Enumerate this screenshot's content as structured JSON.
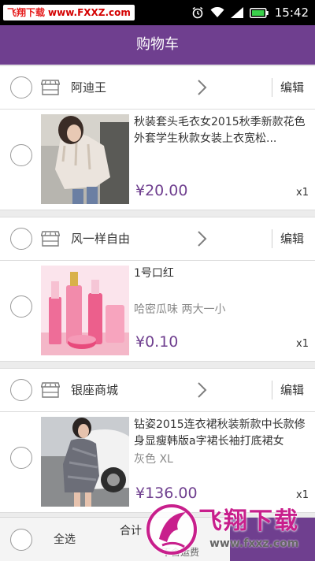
{
  "status_bar": {
    "watermark_name": "飞翔下载",
    "watermark_url": "www.FXXZ.com",
    "time": "15:42",
    "icons": [
      "alarm-icon",
      "wifi-icon",
      "signal-icon",
      "battery-icon"
    ]
  },
  "header": {
    "title": "购物车"
  },
  "shops": [
    {
      "name": "阿迪王",
      "edit_label": "编辑",
      "item": {
        "title": "秋装套头毛衣女2015秋季新款花色外套学生秋款女装上衣宽松...",
        "spec": "",
        "price": "¥20.00",
        "qty": "x1"
      }
    },
    {
      "name": "风一样自由",
      "edit_label": "编辑",
      "item": {
        "title": "1号口红",
        "spec": "哈密瓜味 两大一小",
        "price": "¥0.10",
        "qty": "x1"
      }
    },
    {
      "name": "银座商城",
      "edit_label": "编辑",
      "item": {
        "title": "钻姿2015连衣裙秋装新款中长款修身显瘦韩版a字裙长袖打底裙女",
        "spec": "灰色 XL",
        "price": "¥136.00",
        "qty": "x1"
      }
    }
  ],
  "bottom_bar": {
    "select_all_label": "全选",
    "total_label": "合计",
    "shipping_note": "不含运费"
  },
  "watermark": {
    "brand": "飞翔下载",
    "url": "www.fxxz.com"
  },
  "colors": {
    "accent": "#6f3f8f",
    "header_bg": "#6f3f8f",
    "watermark": "#c81f8c"
  }
}
